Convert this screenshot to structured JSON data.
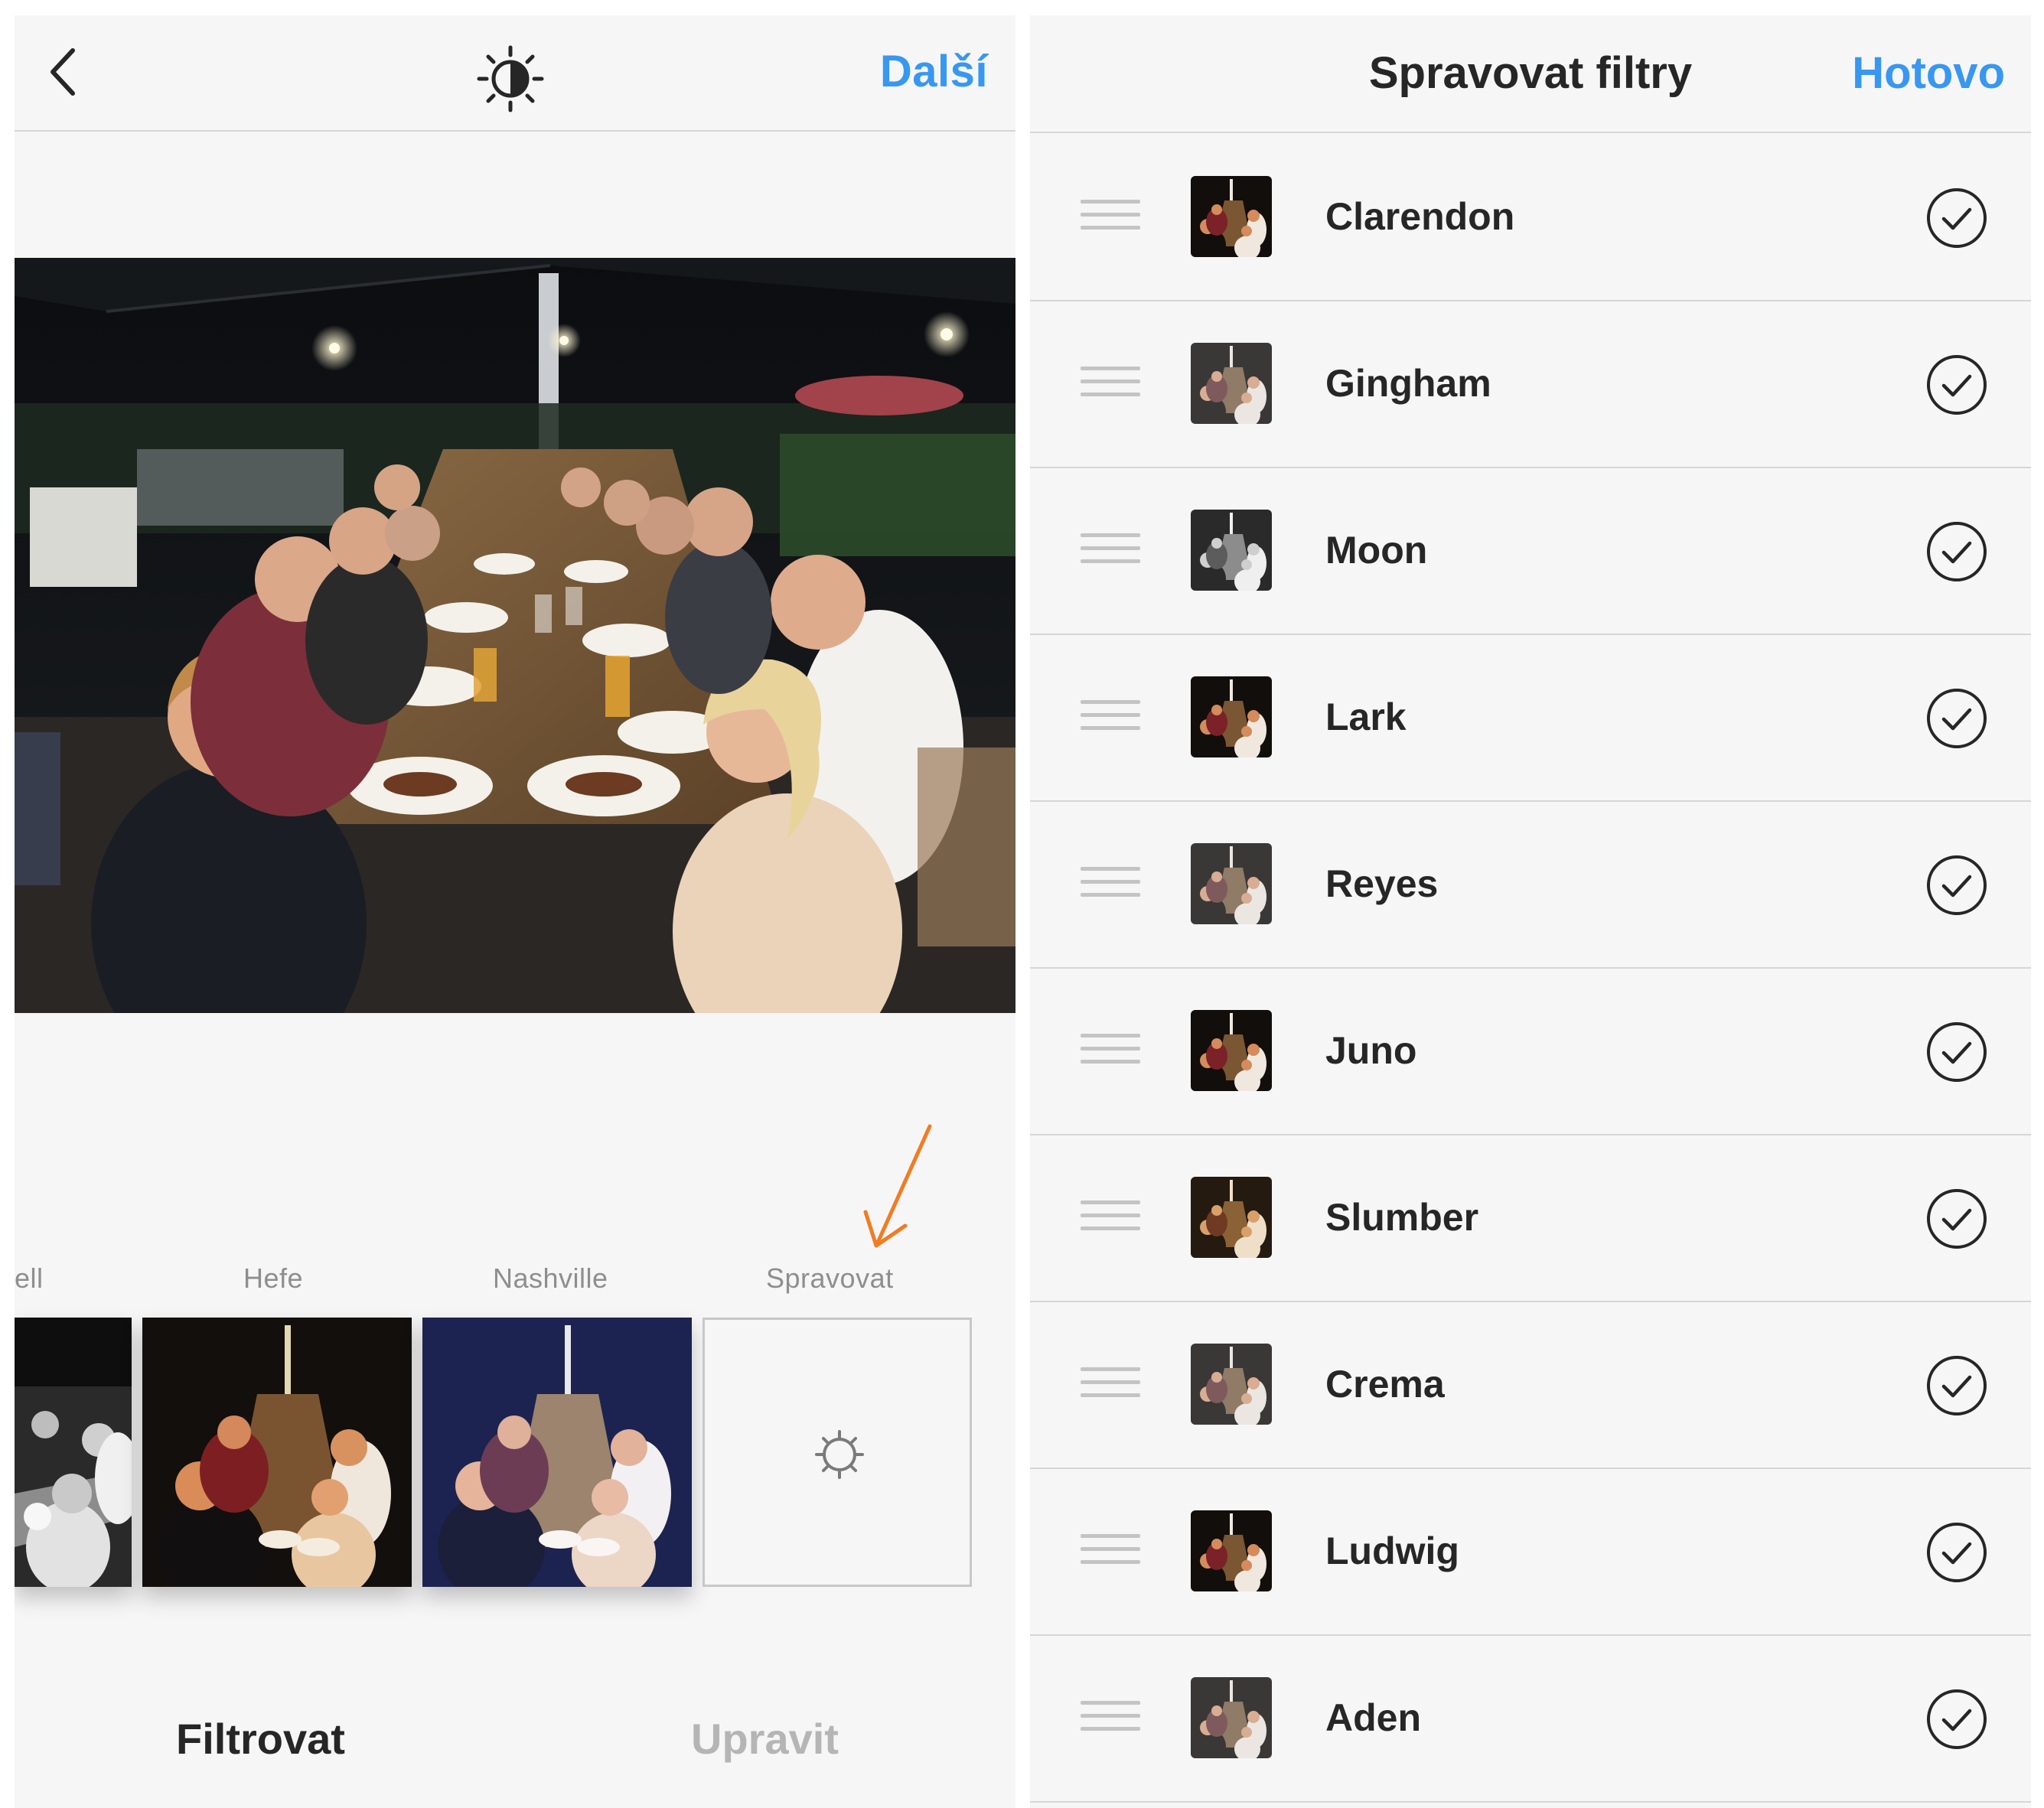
{
  "editor": {
    "next_label": "Další",
    "back_icon": "chevron-left-icon",
    "adjust_icon": "brightness-icon",
    "filters": [
      {
        "label": "ell",
        "style": "bw"
      },
      {
        "label": "Hefe",
        "style": "warm"
      },
      {
        "label": "Nashville",
        "style": "blue"
      }
    ],
    "manage_label": "Spravovat",
    "manage_icon": "gear-icon",
    "tabs": {
      "filter": "Filtrovat",
      "edit": "Upravit"
    },
    "annotation_color": "#f07d23"
  },
  "manage_filters": {
    "title": "Spravovat filtry",
    "done_label": "Hotovo",
    "items": [
      {
        "name": "Clarendon",
        "style": "vivid",
        "checked": true
      },
      {
        "name": "Gingham",
        "style": "faded",
        "checked": true
      },
      {
        "name": "Moon",
        "style": "bw",
        "checked": true
      },
      {
        "name": "Lark",
        "style": "vivid",
        "checked": true
      },
      {
        "name": "Reyes",
        "style": "faded",
        "checked": true
      },
      {
        "name": "Juno",
        "style": "vivid",
        "checked": true
      },
      {
        "name": "Slumber",
        "style": "warm",
        "checked": true
      },
      {
        "name": "Crema",
        "style": "faded",
        "checked": true
      },
      {
        "name": "Ludwig",
        "style": "vivid",
        "checked": true
      },
      {
        "name": "Aden",
        "style": "faded",
        "checked": true
      }
    ]
  },
  "colors": {
    "accent": "#3897f0",
    "text": "#262626",
    "muted": "#b5b5b5",
    "background": "#f6f6f6",
    "divider": "#d6d6d6"
  }
}
